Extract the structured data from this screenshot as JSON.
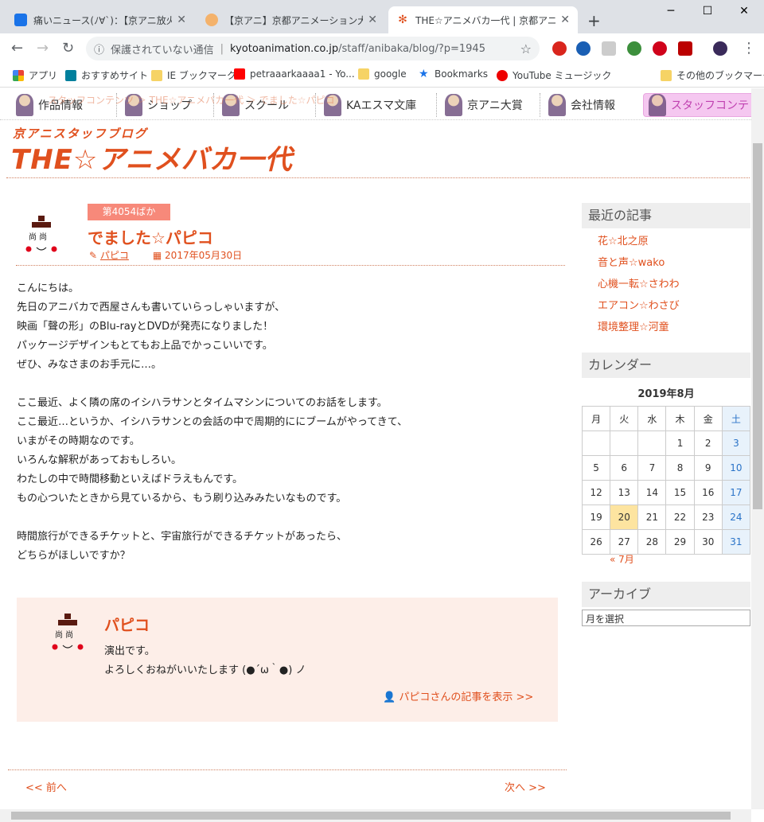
{
  "browser": {
    "tabs": [
      {
        "label": "痛いニュース(ﾉ∀`)：【京アニ放火】 著",
        "active": false
      },
      {
        "label": "【京アニ】京都アニメーション大賞【KA",
        "active": false
      },
      {
        "label": "THE☆アニメバカ一代 | 京都アニメー",
        "active": true
      }
    ],
    "new_tab": "+",
    "window_controls": {
      "minimize": "─",
      "maximize": "☐",
      "close": "✕"
    },
    "address": {
      "security": "保護されていない通信",
      "host": "kyotoanimation.co.jp",
      "path": "/staff/anibaka/blog/?p=1945"
    },
    "bookmarks": [
      "アプリ",
      "おすすめサイト",
      "IE ブックマーク",
      "petraaarkaaaa1 - Yo...",
      "google",
      "Bookmarks",
      "YouTube ミュージック",
      "その他のブックマーク"
    ]
  },
  "site": {
    "nav": [
      "作品情報",
      "ショップ",
      "スクール",
      "KAエスマ文庫",
      "京アニ大賞",
      "会社情報",
      "スタッフコンテ"
    ],
    "breadcrumb": "スタッフコンテンツ ＞ THE☆アニメバカ一代 ＞ でました☆パピコ",
    "logo_sub": "京アニスタッフブログ",
    "logo_main": "THE☆アニメバカ一代"
  },
  "post": {
    "badge": "第4054ばか",
    "title": "でました☆パピコ",
    "author": "パピコ",
    "date": "2017年05月30日",
    "body": [
      "こんにちは。",
      "先日のアニバカで西屋さんも書いていらっしゃいますが、",
      "映画「聲の形」のBlu-rayとDVDが発売になりました！",
      "パッケージデザインもとてもお上品でかっこいいです。",
      "ぜひ、みなさまのお手元に…。",
      "",
      "ここ最近、よく隣の席のイシハラサンとタイムマシンについてのお話をします。",
      "ここ最近…というか、イシハラサンとの会話の中で周期的ににブームがやってきて、",
      "いまがその時期なのです。",
      "いろんな解釈があっておもしろい。",
      "わたしの中で時間移動といえばドラえもんです。",
      "もの心ついたときから見ているから、もう刷り込みみたいなものです。",
      "",
      "時間旅行ができるチケットと、宇宙旅行ができるチケットがあったら、",
      "どちらがほしいですか？"
    ]
  },
  "author_box": {
    "name": "パピコ",
    "line1": "演出です。",
    "line2": "よろしくおねがいいたします (●´ω｀●) ノ",
    "link": "パピコさんの記事を表示 >>"
  },
  "pager": {
    "prev": "<< 前へ",
    "next": "次へ >>"
  },
  "sidebar": {
    "recent_title": "最近の記事",
    "recent": [
      "花☆北之原",
      "音と声☆wako",
      "心機一転☆さわわ",
      "エアコン☆わさび",
      "環境整理☆河童"
    ],
    "calendar_title": "カレンダー",
    "calendar": {
      "month": "2019年8月",
      "weekdays": [
        "月",
        "火",
        "水",
        "木",
        "金",
        "土"
      ],
      "weeks": [
        [
          "",
          "",
          "",
          "1",
          "2",
          "3"
        ],
        [
          "5",
          "6",
          "7",
          "8",
          "9",
          "10"
        ],
        [
          "12",
          "13",
          "14",
          "15",
          "16",
          "17"
        ],
        [
          "19",
          "20",
          "21",
          "22",
          "23",
          "24"
        ],
        [
          "26",
          "27",
          "28",
          "29",
          "30",
          "31"
        ]
      ],
      "today": "20",
      "prev": "« 7月"
    },
    "archive_title": "アーカイブ",
    "archive_select": "月を選択"
  }
}
